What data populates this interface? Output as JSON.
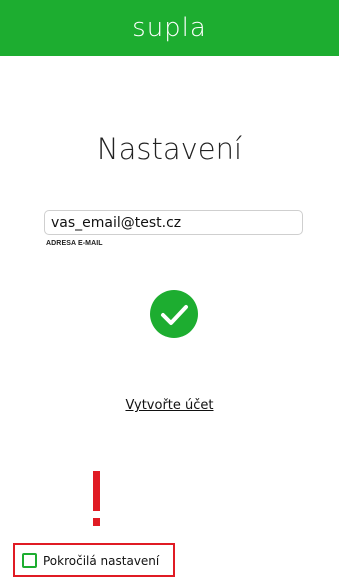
{
  "header": {
    "title": "supla"
  },
  "page": {
    "title": "Nastavení"
  },
  "email": {
    "value": "vas_email@test.cz",
    "label": "ADRESA E-MAIL"
  },
  "status": {
    "icon": "check-circle-icon",
    "color": "#1dad30"
  },
  "links": {
    "create_account": "Vytvořte účet"
  },
  "advanced": {
    "label": "Pokročilá nastavení",
    "checked": false
  },
  "annotation": {
    "color": "#e01b24"
  }
}
